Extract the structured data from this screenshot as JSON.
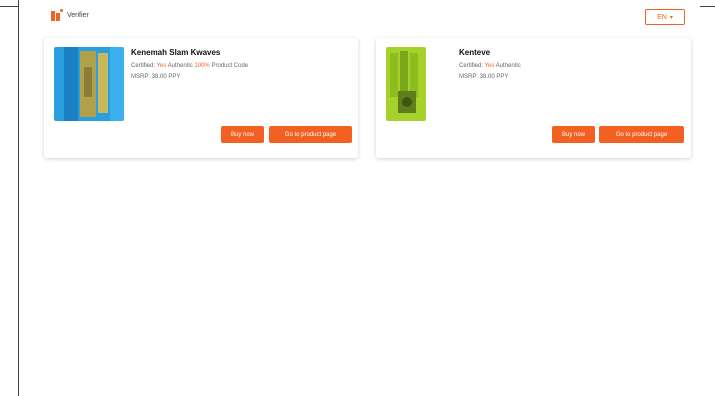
{
  "header": {
    "logo_icon": "brand-logo-icon",
    "logo_text": "Verifier",
    "language": {
      "selected": "EN",
      "icon": "chevron-down-icon"
    }
  },
  "products": [
    {
      "title": "Kenemah Slam Kwaves",
      "line1_a": "Certified:",
      "line1_hl": "Yes",
      "line1_b": "Authentic",
      "line1_hl2": "100%",
      "line1_c": "Product Code",
      "line2": "MSRP: 38.00 PPY",
      "thumb_colors": [
        "#2a9fe0",
        "#b0a14a"
      ],
      "buttons": {
        "primary": "Buy now",
        "secondary": "Go to product page"
      }
    },
    {
      "title": "Kenteve",
      "line1_a": "Certified:",
      "line1_hl": "Yes",
      "line1_b": "Authentic",
      "line2": "MSRP: 38.00 PPY",
      "thumb_colors": [
        "#a6d12a",
        "#5d7e1a"
      ],
      "buttons": {
        "primary": "Buy now",
        "secondary": "Go to product page"
      }
    }
  ]
}
